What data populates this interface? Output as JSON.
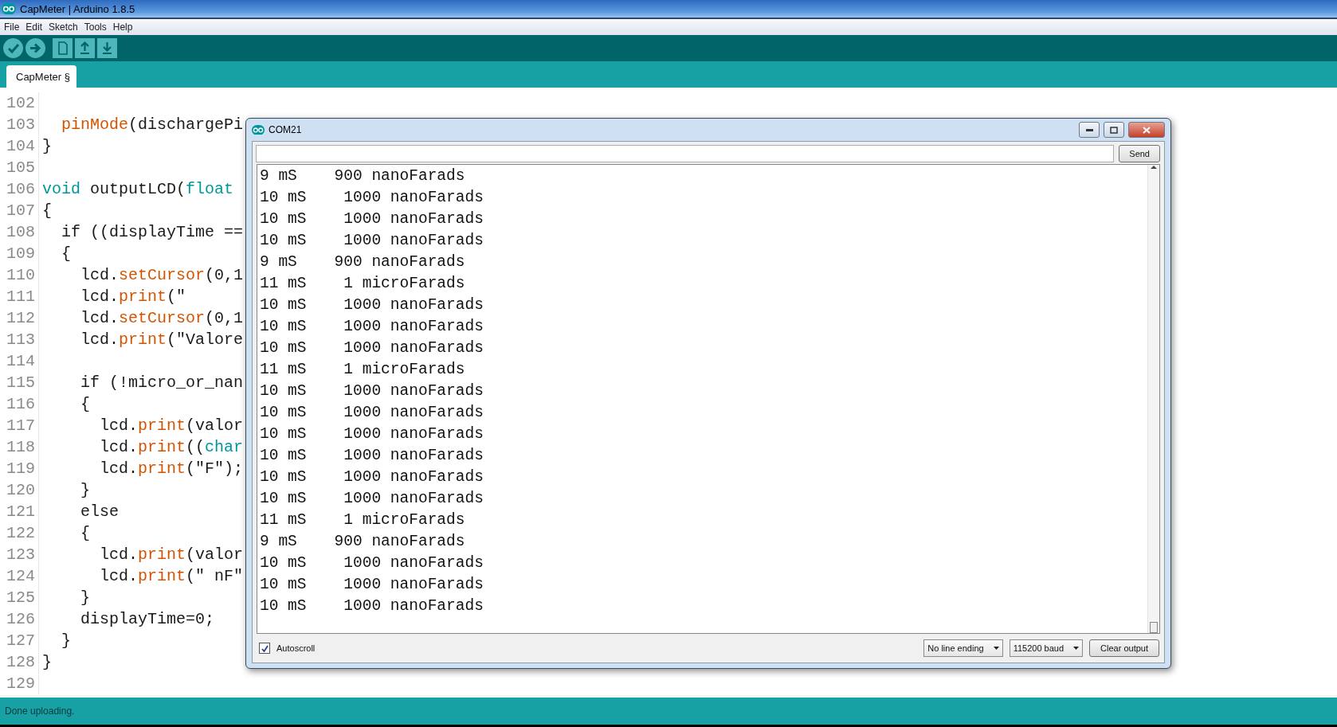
{
  "window": {
    "title": "CapMeter | Arduino 1.8.5"
  },
  "menu": [
    "File",
    "Edit",
    "Sketch",
    "Tools",
    "Help"
  ],
  "toolbar": [
    {
      "kind": "verify"
    },
    {
      "kind": "upload"
    },
    {
      "kind": "new"
    },
    {
      "kind": "open"
    },
    {
      "kind": "save"
    }
  ],
  "tabs": [
    {
      "label": "CapMeter §",
      "selected": true
    }
  ],
  "editor": {
    "lines": [
      {
        "number": "102"
      },
      {
        "number": "103",
        "tokens": [
          {
            "text": "  pinMode",
            "kind": "function"
          },
          {
            "text": "(dischargePi",
            "kind": "plain"
          }
        ]
      },
      {
        "number": "104",
        "tokens": [
          {
            "text": "}",
            "kind": "plain"
          }
        ]
      },
      {
        "number": "105"
      },
      {
        "number": "106",
        "tokens": [
          {
            "text": "void",
            "kind": "keyword"
          },
          {
            "text": " outputLCD(",
            "kind": "plain"
          },
          {
            "text": "float",
            "kind": "keyword"
          }
        ]
      },
      {
        "number": "107",
        "tokens": [
          {
            "text": "{",
            "kind": "plain"
          }
        ]
      },
      {
        "number": "108",
        "tokens": [
          {
            "text": "  if ((displayTime ==",
            "kind": "plain"
          }
        ]
      },
      {
        "number": "109",
        "tokens": [
          {
            "text": "  {",
            "kind": "plain"
          }
        ]
      },
      {
        "number": "110",
        "tokens": [
          {
            "text": "    lcd.",
            "kind": "plain"
          },
          {
            "text": "setCursor",
            "kind": "function"
          },
          {
            "text": "(0,1",
            "kind": "plain"
          }
        ]
      },
      {
        "number": "111",
        "tokens": [
          {
            "text": "    lcd.",
            "kind": "plain"
          },
          {
            "text": "print",
            "kind": "function"
          },
          {
            "text": "(\"",
            "kind": "plain"
          }
        ]
      },
      {
        "number": "112",
        "tokens": [
          {
            "text": "    lcd.",
            "kind": "plain"
          },
          {
            "text": "setCursor",
            "kind": "function"
          },
          {
            "text": "(0,1",
            "kind": "plain"
          }
        ]
      },
      {
        "number": "113",
        "tokens": [
          {
            "text": "    lcd.",
            "kind": "plain"
          },
          {
            "text": "print",
            "kind": "function"
          },
          {
            "text": "(\"Valore",
            "kind": "plain"
          }
        ]
      },
      {
        "number": "114"
      },
      {
        "number": "115",
        "tokens": [
          {
            "text": "    if (!micro_or_nan",
            "kind": "plain"
          }
        ]
      },
      {
        "number": "116",
        "tokens": [
          {
            "text": "    {",
            "kind": "plain"
          }
        ]
      },
      {
        "number": "117",
        "tokens": [
          {
            "text": "      lcd.",
            "kind": "plain"
          },
          {
            "text": "print",
            "kind": "function"
          },
          {
            "text": "(valor",
            "kind": "plain"
          }
        ]
      },
      {
        "number": "118",
        "tokens": [
          {
            "text": "      lcd.",
            "kind": "plain"
          },
          {
            "text": "print",
            "kind": "function"
          },
          {
            "text": "((",
            "kind": "plain"
          },
          {
            "text": "char",
            "kind": "keyword"
          }
        ]
      },
      {
        "number": "119",
        "tokens": [
          {
            "text": "      lcd.",
            "kind": "plain"
          },
          {
            "text": "print",
            "kind": "function"
          },
          {
            "text": "(\"F\");",
            "kind": "plain"
          }
        ]
      },
      {
        "number": "120",
        "tokens": [
          {
            "text": "    }",
            "kind": "plain"
          }
        ]
      },
      {
        "number": "121",
        "tokens": [
          {
            "text": "    else",
            "kind": "plain"
          }
        ]
      },
      {
        "number": "122",
        "tokens": [
          {
            "text": "    {",
            "kind": "plain"
          }
        ]
      },
      {
        "number": "123",
        "tokens": [
          {
            "text": "      lcd.",
            "kind": "plain"
          },
          {
            "text": "print",
            "kind": "function"
          },
          {
            "text": "(valor",
            "kind": "plain"
          }
        ]
      },
      {
        "number": "124",
        "tokens": [
          {
            "text": "      lcd.",
            "kind": "plain"
          },
          {
            "text": "print",
            "kind": "function"
          },
          {
            "text": "(\" nF\"",
            "kind": "plain"
          }
        ]
      },
      {
        "number": "125",
        "tokens": [
          {
            "text": "    }",
            "kind": "plain"
          }
        ]
      },
      {
        "number": "126",
        "tokens": [
          {
            "text": "    displayTime=0;",
            "kind": "plain"
          }
        ]
      },
      {
        "number": "127",
        "tokens": [
          {
            "text": "  }",
            "kind": "plain"
          }
        ]
      },
      {
        "number": "128",
        "tokens": [
          {
            "text": "}",
            "kind": "plain"
          }
        ]
      },
      {
        "number": "129"
      }
    ]
  },
  "serial_monitor": {
    "title": "COM21",
    "send_button": "Send",
    "output": [
      "9 mS    900 nanoFarads",
      "10 mS    1000 nanoFarads",
      "10 mS    1000 nanoFarads",
      "10 mS    1000 nanoFarads",
      "9 mS    900 nanoFarads",
      "11 mS    1 microFarads",
      "10 mS    1000 nanoFarads",
      "10 mS    1000 nanoFarads",
      "10 mS    1000 nanoFarads",
      "11 mS    1 microFarads",
      "10 mS    1000 nanoFarads",
      "10 mS    1000 nanoFarads",
      "10 mS    1000 nanoFarads",
      "10 mS    1000 nanoFarads",
      "10 mS    1000 nanoFarads",
      "10 mS    1000 nanoFarads",
      "11 mS    1 microFarads",
      "9 mS    900 nanoFarads",
      "10 mS    1000 nanoFarads",
      "10 mS    1000 nanoFarads",
      "10 mS    1000 nanoFarads"
    ],
    "autoscroll": {
      "label": "Autoscroll",
      "checked": true
    },
    "line_ending": "No line ending",
    "baud": "115200 baud",
    "clear_button": "Clear output"
  },
  "status_bar": "Done uploading."
}
